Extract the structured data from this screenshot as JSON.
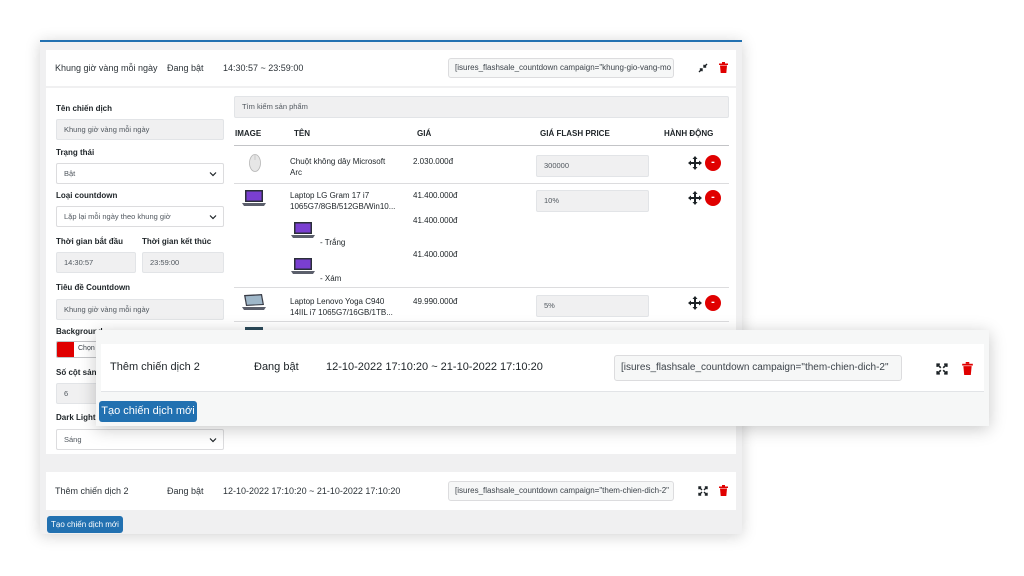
{
  "campaign1": {
    "name": "Khung giờ vàng mỗi ngày",
    "status": "Đang bật",
    "time_range": "14:30:57 ~ 23:59:00",
    "shortcode": "[isures_flashsale_countdown campaign=\"khung-gio-vang-mo"
  },
  "form": {
    "campaign_name_label": "Tên chiến dịch",
    "campaign_name_value": "Khung giờ vàng mỗi ngày",
    "status_label": "Trạng thái",
    "status_value": "Bật",
    "countdown_type_label": "Loại countdown",
    "countdown_type_value": "Lặp lại mỗi ngày theo khung giờ",
    "start_time_label": "Thời gian bắt đầu",
    "start_time_value": "14:30:57",
    "end_time_label": "Thời gian kết thúc",
    "end_time_value": "23:59:00",
    "countdown_title_label": "Tiêu đề Countdown",
    "countdown_title_value": "Khung giờ vàng mỗi ngày",
    "background_label": "Background",
    "color_button_label": "Chọn m",
    "columns_label": "Số cột sản",
    "columns_value": "6",
    "dark_light_label": "Dark Light",
    "dark_light_value": "Sáng"
  },
  "products": {
    "search_placeholder": "Tìm kiếm sản phẩm",
    "headers": {
      "image": "IMAGE",
      "name": "TÊN",
      "price": "GIÁ",
      "flash_price": "GIÁ FLASH PRICE",
      "action": "HÀNH ĐỘNG"
    },
    "rows": [
      {
        "name": "Chuột không dây Microsoft Arc",
        "name_line1": "Chuột không dây Microsoft",
        "name_line2": "Arc",
        "price": "2.030.000đ",
        "flash_price": "300000"
      },
      {
        "name_line1": "Laptop LG Gram 17 i7",
        "name_line2": "1065G7/8GB/512GB/Win10...",
        "price": "41.400.000đ",
        "flash_price": "10%",
        "variants": [
          {
            "label": "- Trắng",
            "price": "41.400.000đ"
          },
          {
            "label": "- Xám",
            "price": "41.400.000đ"
          }
        ]
      },
      {
        "name_line1": "Laptop Lenovo Yoga C940",
        "name_line2": "14IIL i7 1065G7/16GB/1TB...",
        "price": "49.990.000đ",
        "flash_price": "5%"
      }
    ],
    "remove_symbol": "-"
  },
  "campaign2": {
    "name": "Thêm chiến dịch 2",
    "status": "Đang bật",
    "time_range": "12-10-2022 17:10:20 ~ 21-10-2022 17:10:20",
    "shortcode": "[isures_flashsale_countdown campaign=\"them-chien-dich-2\""
  },
  "create_button_label": "Tạo chiến dịch mới",
  "colors": {
    "accent": "#2271b1",
    "danger": "#e00000",
    "swatch": "#e00000"
  }
}
